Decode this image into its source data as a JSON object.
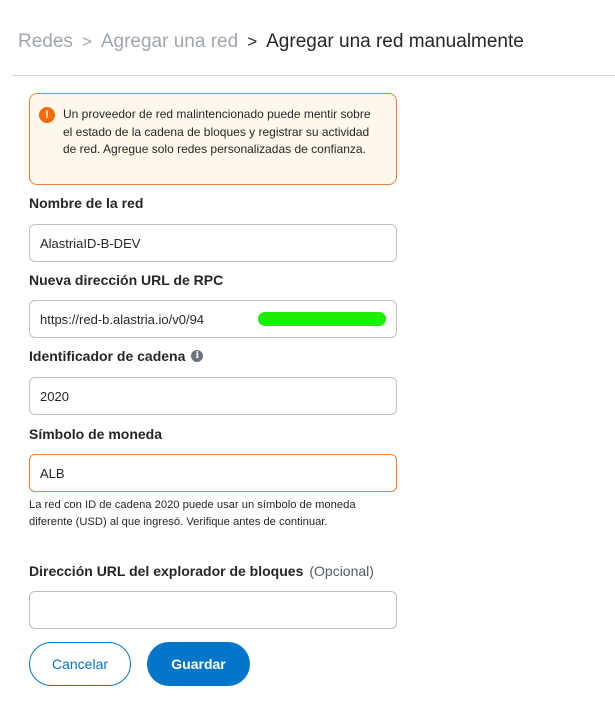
{
  "breadcrumb": {
    "items": [
      "Redes",
      "Agregar una red"
    ],
    "current": "Agregar una red manualmente",
    "separator": ">"
  },
  "warning": {
    "icon": "!",
    "text": "Un proveedor de red malintencionado puede mentir sobre el estado de la cadena de bloques y registrar su actividad de red. Agregue solo redes personalizadas de confianza."
  },
  "fields": {
    "network_name": {
      "label": "Nombre de la red",
      "value": "AlastriaID-B-DEV"
    },
    "rpc_url": {
      "label": "Nueva dirección URL de RPC",
      "value": "https://red-b.alastria.io/v0/94"
    },
    "chain_id": {
      "label": "Identificador de cadena",
      "info_icon": "i",
      "value": "2020"
    },
    "currency_symbol": {
      "label": "Símbolo de moneda",
      "value": "ALB",
      "helper": "La red con ID de cadena 2020 puede usar un símbolo de moneda diferente (USD) al que ingresó. Verifique antes de continuar."
    },
    "block_explorer": {
      "label": "Dirección URL del explorador de bloques",
      "optional": "(Opcional)",
      "value": ""
    }
  },
  "buttons": {
    "cancel": "Cancelar",
    "save": "Guardar"
  },
  "colors": {
    "primary": "#0376c9",
    "warning_border": "#e8813b",
    "warning_bg": "#fef8ea",
    "redaction": "#1cf000"
  }
}
